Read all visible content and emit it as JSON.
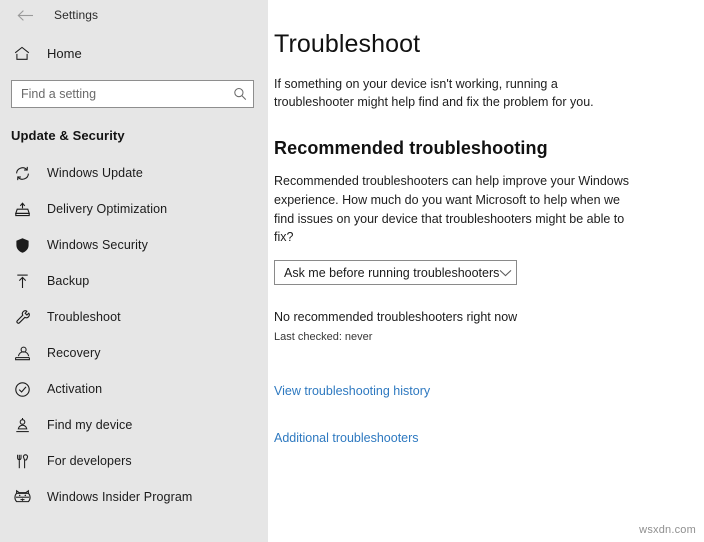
{
  "window": {
    "app_title": "Settings",
    "back_icon": "back-arrow-icon"
  },
  "sidebar": {
    "home": {
      "label": "Home",
      "icon": "home-icon"
    },
    "search": {
      "placeholder": "Find a setting",
      "value": "",
      "icon": "search-icon"
    },
    "section_title": "Update & Security",
    "items": [
      {
        "label": "Windows Update",
        "icon": "sync-icon"
      },
      {
        "label": "Delivery Optimization",
        "icon": "delivery-box-icon"
      },
      {
        "label": "Windows Security",
        "icon": "shield-icon"
      },
      {
        "label": "Backup",
        "icon": "upload-arrow-icon"
      },
      {
        "label": "Troubleshoot",
        "icon": "wrench-icon"
      },
      {
        "label": "Recovery",
        "icon": "recovery-icon"
      },
      {
        "label": "Activation",
        "icon": "check-circle-icon"
      },
      {
        "label": "Find my device",
        "icon": "person-location-icon"
      },
      {
        "label": "For developers",
        "icon": "tools-icon"
      },
      {
        "label": "Windows Insider Program",
        "icon": "ninja-cat-icon"
      }
    ]
  },
  "main": {
    "page_title": "Troubleshoot",
    "page_description": "If something on your device isn't working, running a troubleshooter might help find and fix the problem for you.",
    "recommended": {
      "heading": "Recommended troubleshooting",
      "description": "Recommended troubleshooters can help improve your Windows experience. How much do you want Microsoft to help when we find issues on your device that troubleshooters might be able to fix?",
      "dropdown": {
        "selected": "Ask me before running troubleshooters",
        "chevron_icon": "chevron-down-icon"
      },
      "status": "No recommended troubleshooters right now",
      "last_checked": "Last checked: never"
    },
    "links": [
      {
        "label": "View troubleshooting history"
      },
      {
        "label": "Additional troubleshooters"
      }
    ]
  },
  "watermark": "wsxdn.com",
  "colors": {
    "sidebar_bg": "#e6e6e6",
    "content_bg": "#ffffff",
    "link": "#2e79c0",
    "text": "#1b1b1b"
  }
}
